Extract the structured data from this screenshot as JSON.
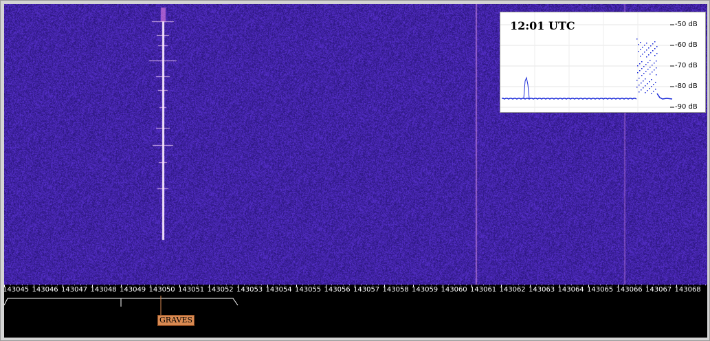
{
  "spectrum": {
    "time": "12:01 UTC",
    "db_scale": [
      "-50 dB",
      "-60 dB",
      "-70 dB",
      "-80 dB",
      "-90 dB"
    ]
  },
  "frequency_scale": {
    "labels": [
      "143045",
      "143046",
      "143047",
      "143048",
      "143049",
      "143050",
      "143051",
      "143052",
      "143053",
      "143054",
      "143055",
      "143056",
      "143057",
      "143058",
      "143059",
      "143060",
      "143061",
      "143062",
      "143063",
      "143064",
      "143065",
      "143066",
      "143067",
      "143068"
    ]
  },
  "marker": {
    "label": "GRAVES",
    "frequency": "143050"
  },
  "colors": {
    "waterfall_bg": "#3a1a9a",
    "signal": "#ffffff",
    "marker_tag": "#d98a52",
    "spectrum_trace": "#1a2ad8"
  }
}
